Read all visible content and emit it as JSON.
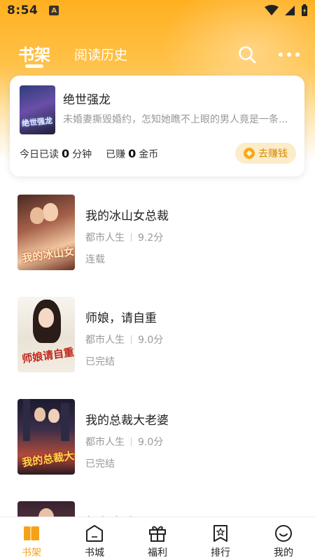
{
  "status_bar": {
    "time": "8:54",
    "notification": "A"
  },
  "header": {
    "tabs": [
      {
        "label": "书架",
        "active": true
      },
      {
        "label": "阅读历史",
        "active": false
      }
    ],
    "search_icon": "search-icon",
    "more_icon": "more-icon"
  },
  "current_book": {
    "title": "绝世强龙",
    "cover_text": "绝世强龙",
    "description": "未婚妻撕毁婚约，怎知她瞧不上眼的男人竟是一条...",
    "read_prefix": "今日已读",
    "read_minutes": "0",
    "read_unit": "分钟",
    "earned_prefix": "已赚",
    "earned_coins": "0",
    "earned_unit": "金币",
    "earn_button": "去赚钱"
  },
  "books": [
    {
      "title": "我的冰山女总裁",
      "category": "都市人生",
      "score": "9.2分",
      "status": "连载",
      "cover_text": "我的冰山女总裁"
    },
    {
      "title": "师娘，请自重",
      "category": "都市人生",
      "score": "9.0分",
      "status": "已完结",
      "cover_text": "师娘请自重"
    },
    {
      "title": "我的总裁大老婆",
      "category": "都市人生",
      "score": "9.0分",
      "status": "已完结",
      "cover_text": "我的总裁大老婆"
    },
    {
      "title": "都市逍遥王医",
      "category": "",
      "score": "",
      "status": "",
      "cover_text": ""
    }
  ],
  "bottom_nav": [
    {
      "label": "书架",
      "icon": "bookshelf-icon",
      "active": true
    },
    {
      "label": "书城",
      "icon": "bookstore-icon",
      "active": false
    },
    {
      "label": "福利",
      "icon": "gift-icon",
      "active": false
    },
    {
      "label": "排行",
      "icon": "ranking-icon",
      "active": false
    },
    {
      "label": "我的",
      "icon": "profile-icon",
      "active": false
    }
  ],
  "colors": {
    "accent": "#f5a21a",
    "header_gradient": "#ffb020"
  }
}
